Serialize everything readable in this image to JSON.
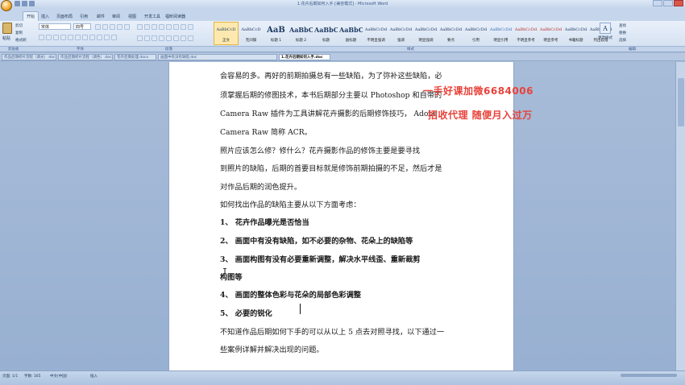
{
  "window": {
    "title": "1.花卉后期如何入手 [兼容模式] - Microsoft Word"
  },
  "ribbon_tabs": [
    "开始",
    "插入",
    "页面布局",
    "引用",
    "邮件",
    "审阅",
    "视图",
    "开发工具",
    "福昕阅读器"
  ],
  "clipboard": {
    "paste_label": "粘贴",
    "cut": "剪切",
    "copy": "复制",
    "format_painter": "格式刷"
  },
  "font": {
    "name": "宋体",
    "size": "四号"
  },
  "styles": [
    {
      "sample": "AaBbCcD",
      "name": "正文",
      "kind": "normal"
    },
    {
      "sample": "AaBbCcD",
      "name": "无间隔",
      "kind": "normal"
    },
    {
      "sample": "AaB",
      "name": "标题 1",
      "kind": "big"
    },
    {
      "sample": "AaBbC",
      "name": "标题 2",
      "kind": "mid"
    },
    {
      "sample": "AaBbC",
      "name": "标题",
      "kind": "mid"
    },
    {
      "sample": "AaBbC",
      "name": "副标题",
      "kind": "mid"
    },
    {
      "sample": "AaBbCcDd",
      "name": "不明显强调",
      "kind": "normal"
    },
    {
      "sample": "AaBbCcDd",
      "name": "强调",
      "kind": "normal"
    },
    {
      "sample": "AaBbCcDd",
      "name": "明显强调",
      "kind": "normal"
    },
    {
      "sample": "AaBbCcDd",
      "name": "要点",
      "kind": "normal"
    },
    {
      "sample": "AaBbCcDd",
      "name": "引用",
      "kind": "normal"
    },
    {
      "sample": "AaBbCcDd",
      "name": "明显引用",
      "kind": "blue"
    },
    {
      "sample": "AaBbCcDd",
      "name": "不明显参考",
      "kind": "red"
    },
    {
      "sample": "AaBbCcDd",
      "name": "明显参考",
      "kind": "red"
    },
    {
      "sample": "AaBbCcDd",
      "name": "书籍标题",
      "kind": "normal"
    },
    {
      "sample": "AaBbCcDd",
      "name": "列出段落",
      "kind": "normal"
    }
  ],
  "change_styles": "更改样式",
  "editing": {
    "find": "查找",
    "replace": "替换",
    "select": "选择"
  },
  "group_labels": {
    "clipboard": "剪贴板",
    "font": "字体",
    "paragraph": "段落",
    "styles": "样式",
    "editing": "编辑"
  },
  "doc_tabs": [
    "作品后期修片流程（调光）.doc",
    "作品后期修片流程（调色）.doc",
    "花卉后期处理.docx",
    "画面中有没有缺陷.doc",
    "1.花卉后期如何入手.doc"
  ],
  "document": {
    "lines": [
      {
        "text": "会容易的多。再好的前期拍摄总有一些缺陷，为了弥补这些缺陷，必",
        "bold": false
      },
      {
        "text": "须掌握后期的修图技术，本书后期部分主要以 Photoshop 和自带的",
        "bold": false
      },
      {
        "text": "Camera Raw 插件为工具讲解花卉摄影的后期修饰技巧， Adobe",
        "bold": false
      },
      {
        "text": "Camera Raw 简称 ACR。",
        "bold": false
      },
      {
        "text": "    照片应该怎么修？修什么？花卉摄影作品的修饰主要是要寻找",
        "bold": false
      },
      {
        "text": "到照片的缺陷，后期的首要目标就是修饰前期拍摄的不足，然后才是",
        "bold": false
      },
      {
        "text": "对作品后期的润色提升。",
        "bold": false
      },
      {
        "text": "    如何找出作品的缺陷主要从以下方面考虑：",
        "bold": false
      },
      {
        "text": "    1、  花卉作品曝光是否恰当",
        "bold": true
      },
      {
        "text": "    2、  画面中有没有缺陷，如不必要的杂物、花朵上的缺陷等",
        "bold": true
      },
      {
        "text": "    3、  画面构图有没有必要重新调整，解决水平线歪、重新裁剪",
        "bold": true
      },
      {
        "text": "           构图等",
        "bold": true
      },
      {
        "text": "    4、  画面的整体色彩与花朵的局部色彩调整",
        "bold": true
      },
      {
        "text": "    5、  必要的锐化",
        "bold": true
      },
      {
        "text": "不知道作品后期如何下手的可以从以上 5 点去对照寻找，以下通过一",
        "bold": false
      },
      {
        "text": "些案例详解并解决出现的问题。",
        "bold": false
      }
    ]
  },
  "watermark": {
    "line1": "一手好课加微6684006",
    "line2": "招收代理 随便月入过万",
    "color": "#e8423a"
  },
  "status": {
    "page": "页面: 1/1",
    "words": "字数: 165",
    "lang": "中文(中国)",
    "mode": "插入"
  }
}
